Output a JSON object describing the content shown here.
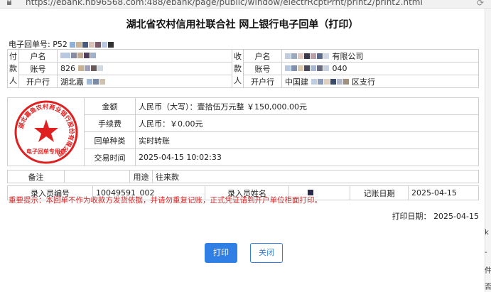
{
  "browser": {
    "url": "https://ebank.hb96568.com:488/ebank/page/public/window/electrRcptPrnt/print2/print2.html"
  },
  "title": "湖北省农村信用社联合社 网上银行电子回单（打印）",
  "receipt": {
    "no_label": "电子回单号:",
    "no_value": "P52"
  },
  "payer": {
    "side_label": [
      "付",
      "款",
      "人"
    ],
    "name_label": "户名",
    "name_value": "",
    "account_label": "账号",
    "account_value": "826",
    "bank_label": "开户行",
    "bank_value": "湖北嘉"
  },
  "payee": {
    "side_label": [
      "收",
      "款",
      "人"
    ],
    "name_label": "户名",
    "name_value": "有限公司",
    "account_label": "账号",
    "account_value": "040",
    "bank_label": "开户行",
    "bank_value_prefix": "中国建",
    "bank_value_suffix": "区支行"
  },
  "details": {
    "amount_label": "金额",
    "amount_value": "人民币（大写）：壹拾伍万元整 ￥150,000.00元",
    "fee_label": "手续费",
    "fee_value": "人民币：￥0.00元",
    "type_label": "回单种类",
    "type_value": "实时转账",
    "time_label": "交易时间",
    "time_value": "2025-04-15 10:02:33"
  },
  "seal": {
    "ring_text": "湖北嘉鱼农村商业银行股份有限公司",
    "bottom_text": "电子回单专用章",
    "color": "#e02020"
  },
  "remark": {
    "remark_label": "备注",
    "remark_value": "",
    "usage_label": "用途",
    "usage_value": "往来款"
  },
  "entry": {
    "clerk_no_label": "录入员编号",
    "clerk_no_value": "10049591_002",
    "clerk_name_label": "录入员姓名",
    "clerk_name_value": "",
    "date_label": "记账日期",
    "date_value": "2025-04-15"
  },
  "warning": "重要提示：本回单不作为收款方发货依据，并请勿重复记账，正式凭证请到开户单位柜面打印。",
  "print_date": {
    "label": "打印日期：",
    "value": "2025-04-15"
  },
  "buttons": {
    "print": "打印",
    "close": "关闭"
  },
  "edge": {
    "items": [
      "k",
      "-",
      "件",
      "否"
    ]
  },
  "colors": {
    "accent": "#2f7fe4",
    "warning": "#d42a2a",
    "border": "#cfcfcf"
  }
}
